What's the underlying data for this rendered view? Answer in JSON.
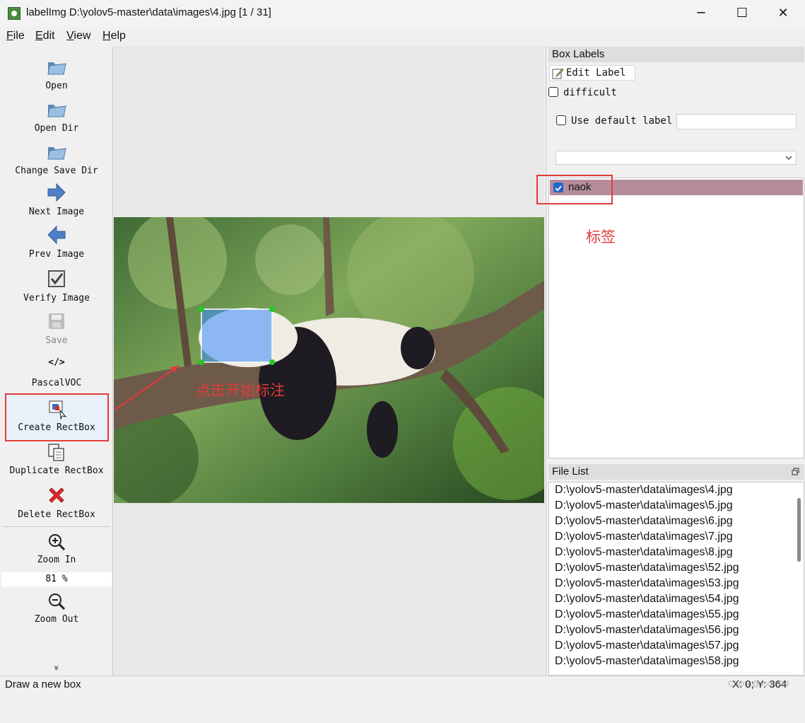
{
  "window": {
    "title": "labelImg D:\\yolov5-master\\data\\images\\4.jpg [1 / 31]"
  },
  "window_controls": {
    "minimize": "─",
    "maximize": "☐",
    "close": "✕"
  },
  "menu": [
    {
      "accel": "F",
      "rest": "ile"
    },
    {
      "accel": "E",
      "rest": "dit"
    },
    {
      "accel": "V",
      "rest": "iew"
    },
    {
      "accel": "H",
      "rest": "elp"
    }
  ],
  "toolbar": {
    "open": "Open",
    "open_dir": "Open Dir",
    "change_save_dir": "Change Save Dir",
    "next_image": "Next Image",
    "prev_image": "Prev Image",
    "verify_image": "Verify Image",
    "save": "Save",
    "format_icon": "</>",
    "format": "PascalVOC",
    "create_rectbox": "Create RectBox",
    "duplicate_rectbox": "Duplicate RectBox",
    "delete_rectbox": "Delete RectBox",
    "zoom_in": "Zoom In",
    "zoom_value": "81 %",
    "zoom_out": "Zoom Out",
    "more_glyph": "»"
  },
  "box_labels": {
    "title": "Box Labels",
    "edit_label": "Edit Label",
    "difficult": "difficult",
    "difficult_checked": false,
    "use_default_label": "Use default label",
    "use_default_checked": false,
    "default_label_value": "",
    "labels": [
      {
        "name": "naok",
        "checked": true
      }
    ]
  },
  "file_list": {
    "title": "File List",
    "files": [
      "D:\\yolov5-master\\data\\images\\4.jpg",
      "D:\\yolov5-master\\data\\images\\5.jpg",
      "D:\\yolov5-master\\data\\images\\6.jpg",
      "D:\\yolov5-master\\data\\images\\7.jpg",
      "D:\\yolov5-master\\data\\images\\8.jpg",
      "D:\\yolov5-master\\data\\images\\52.jpg",
      "D:\\yolov5-master\\data\\images\\53.jpg",
      "D:\\yolov5-master\\data\\images\\54.jpg",
      "D:\\yolov5-master\\data\\images\\55.jpg",
      "D:\\yolov5-master\\data\\images\\56.jpg",
      "D:\\yolov5-master\\data\\images\\57.jpg",
      "D:\\yolov5-master\\data\\images\\58.jpg"
    ]
  },
  "annotations": {
    "label_note": "标签",
    "start_note": "点击开始标注"
  },
  "status": {
    "message": "Draw a new box",
    "coords": "X: 0; Y: 364",
    "watermark": "CSDN @vsdkd23"
  },
  "colors": {
    "annotation_red": "#e23b3b",
    "label_row_bg": "#b48c9c",
    "box_fill": "#3c8cff",
    "handle_green": "#22cc22"
  }
}
